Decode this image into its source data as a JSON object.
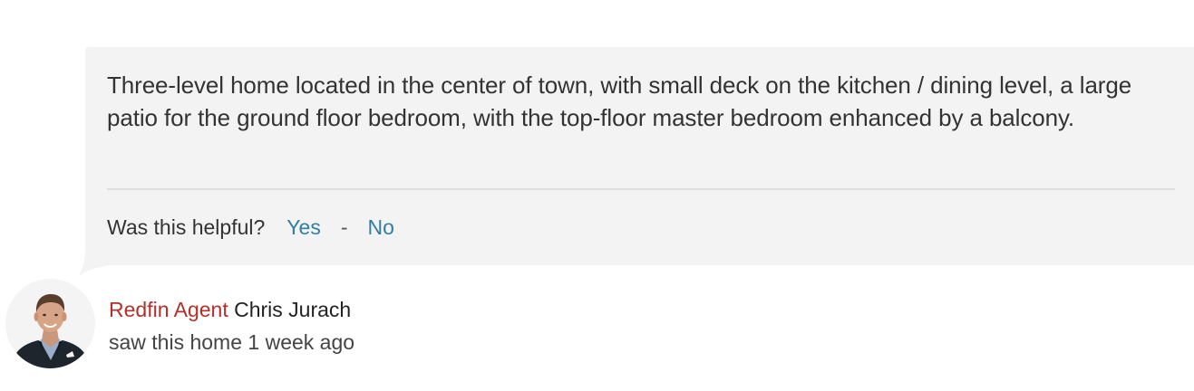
{
  "review": {
    "text": "Three-level home located in the center of town, with small deck on the kitchen / dining level, a large patio for the ground floor bedroom, with the top-floor master bedroom enhanced by a balcony."
  },
  "feedback": {
    "question": "Was this helpful?",
    "yes_label": "Yes",
    "separator": "-",
    "no_label": "No"
  },
  "agent": {
    "role": "Redfin Agent",
    "name": "Chris Jurach",
    "visit_note": "saw this home 1 week ago",
    "avatar_icon": "agent-photo"
  },
  "colors": {
    "card_background": "#f3f3f3",
    "link": "#2f7fa4",
    "brand_red": "#b3302b",
    "text": "#333333"
  }
}
